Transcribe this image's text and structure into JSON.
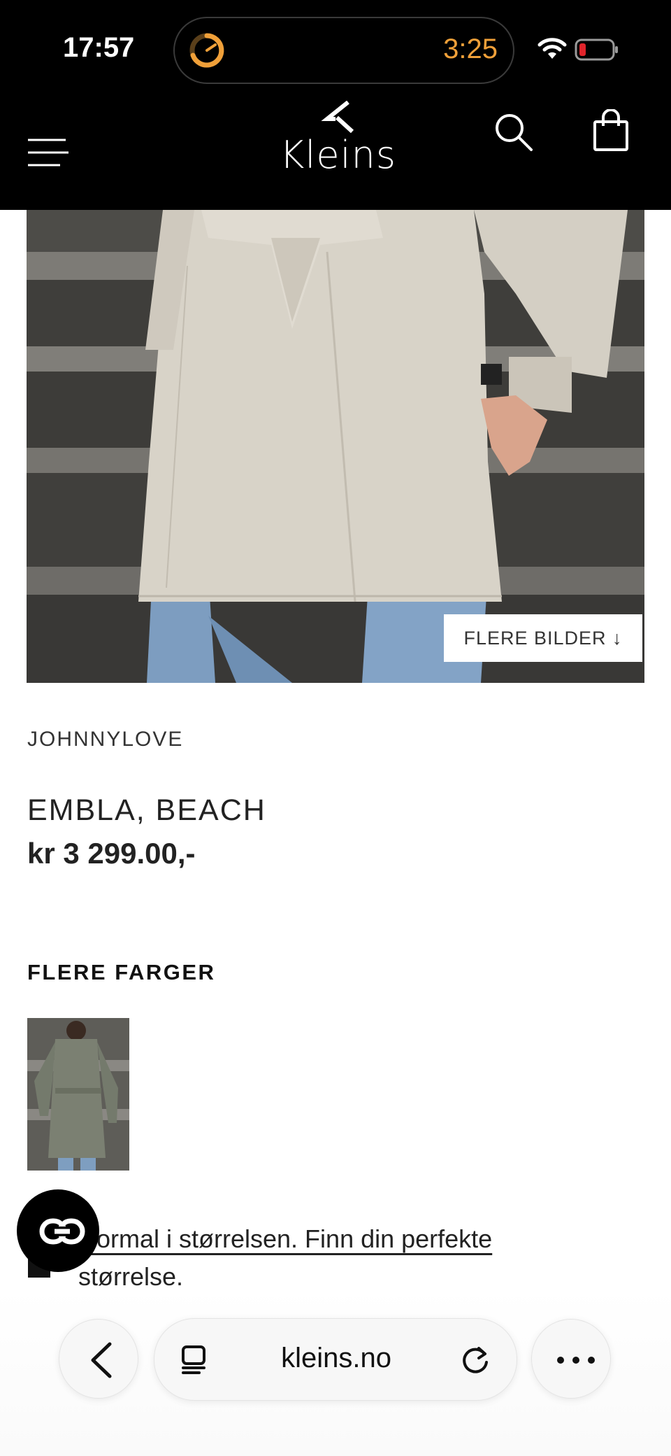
{
  "status_bar": {
    "time": "17:57",
    "timer": "3:25",
    "timer_color": "#f0a039",
    "battery_color": "#e0242b",
    "icons": [
      "timer-icon",
      "wifi-icon",
      "battery-icon"
    ]
  },
  "header": {
    "logo_text": "Kleins",
    "icons": [
      "menu-icon",
      "search-icon",
      "shopping-bag-icon"
    ]
  },
  "product_image": {
    "more_images_label": "FLERE BILDER ↓"
  },
  "product": {
    "brand": "JOHNNYLOVE",
    "name": "EMBLA, BEACH",
    "price": "kr 3 299.00,-"
  },
  "colors": {
    "title": "FLERE FARGER"
  },
  "size_guide": {
    "link_text": "Normal i størrelsen. Finn din perfekte",
    "text_after": "størrelse."
  },
  "browser": {
    "url": "kleins.no",
    "icons": [
      "back-icon",
      "tabs-icon",
      "reload-icon",
      "more-icon"
    ]
  }
}
